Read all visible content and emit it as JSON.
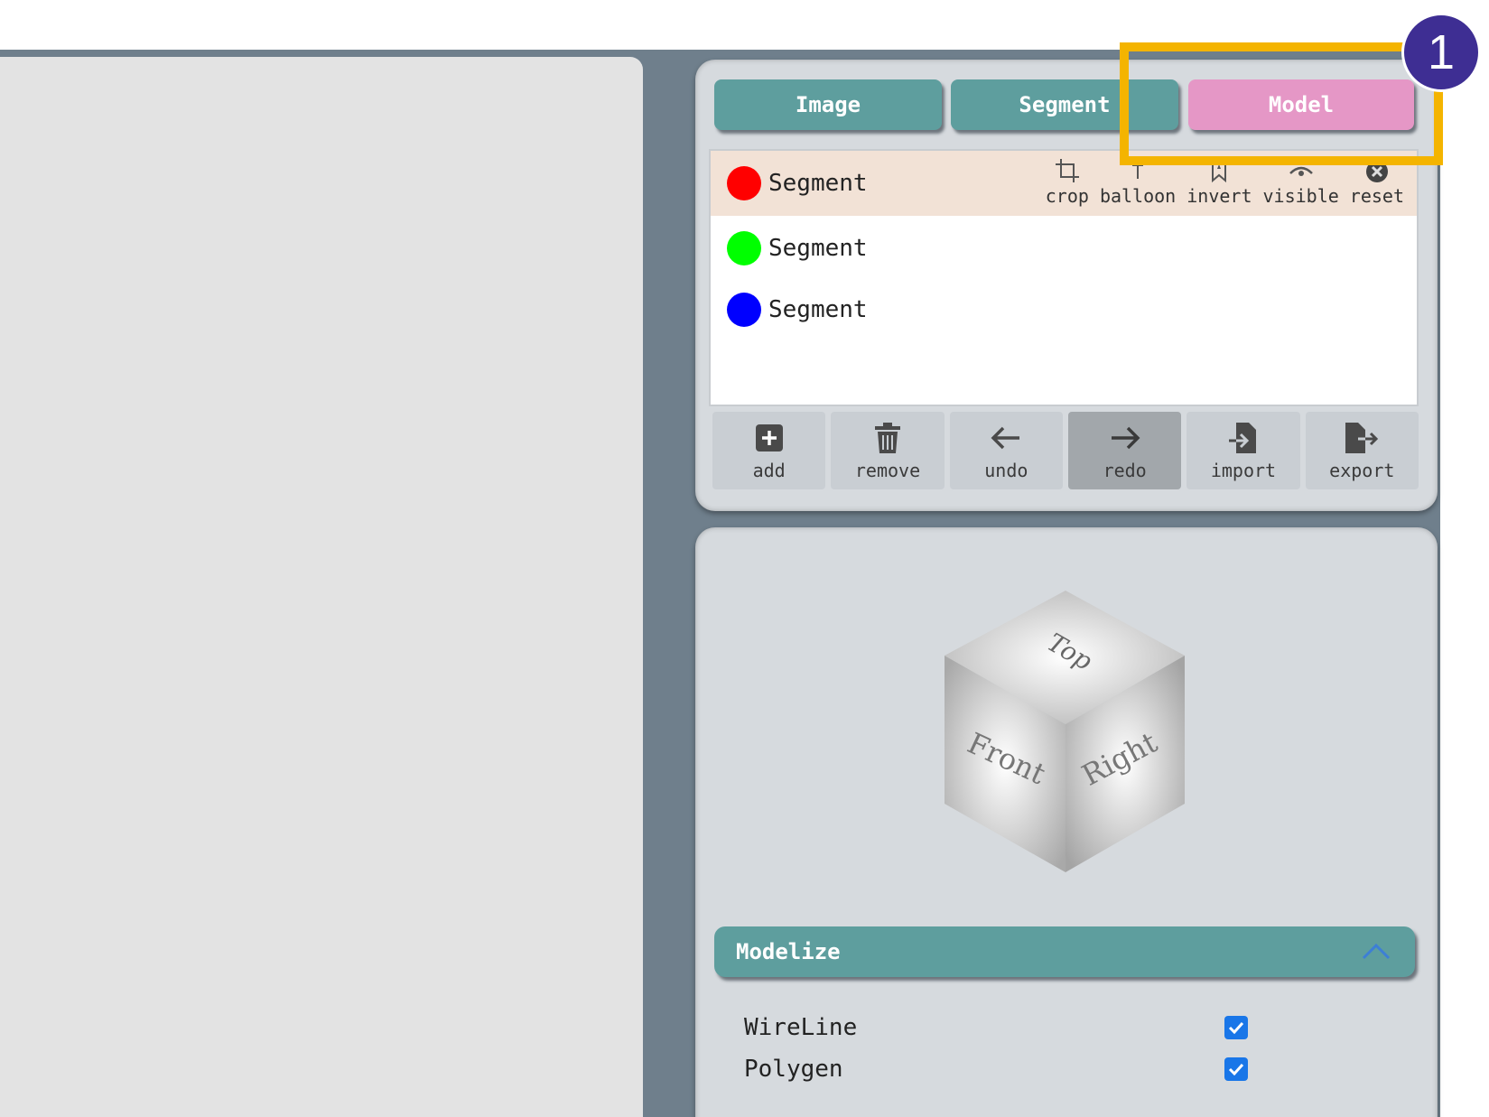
{
  "tabs": [
    {
      "label": "Image"
    },
    {
      "label": "Segment"
    },
    {
      "label": "Model"
    }
  ],
  "active_tab": "Model",
  "segments": [
    {
      "label": "Segment",
      "color": "#ff0000"
    },
    {
      "label": "Segment",
      "color": "#00ff00"
    },
    {
      "label": "Segment",
      "color": "#0000ff"
    }
  ],
  "segment_tools": [
    {
      "label": "crop",
      "icon": "crop-icon"
    },
    {
      "label": "balloon",
      "icon": "pin-icon"
    },
    {
      "label": "invert",
      "icon": "bookmark-icon"
    },
    {
      "label": "visible",
      "icon": "eye-icon"
    },
    {
      "label": "reset",
      "icon": "reset-icon"
    }
  ],
  "toolbar": [
    {
      "label": "add",
      "icon": "plus-square-icon"
    },
    {
      "label": "remove",
      "icon": "trash-icon"
    },
    {
      "label": "undo",
      "icon": "arrow-left-icon"
    },
    {
      "label": "redo",
      "icon": "arrow-right-icon"
    },
    {
      "label": "import",
      "icon": "file-import-icon"
    },
    {
      "label": "export",
      "icon": "file-export-icon"
    }
  ],
  "view_cube": {
    "top": "Top",
    "front": "Front",
    "right": "Right"
  },
  "section": {
    "title": "Modelize",
    "expanded": true
  },
  "options": [
    {
      "label": "WireLine",
      "checked": true
    },
    {
      "label": "Polygen",
      "checked": true
    }
  ],
  "annotation": {
    "number": "1",
    "color": "#f4b400",
    "badge_color": "#3e2e93"
  }
}
